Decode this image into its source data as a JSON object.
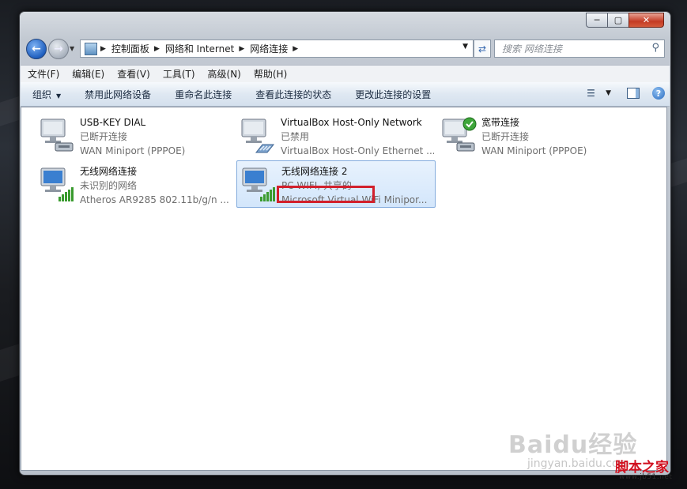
{
  "window": {
    "caption_buttons": {
      "minimize": "─",
      "maximize": "▢",
      "close": "✕"
    }
  },
  "navigation": {
    "back_icon": "arrow-left-icon",
    "forward_icon": "arrow-right-icon",
    "breadcrumb": [
      "控制面板",
      "网络和 Internet",
      "网络连接"
    ],
    "search_placeholder": "搜索 网络连接"
  },
  "menubar": {
    "items": [
      "文件(F)",
      "编辑(E)",
      "查看(V)",
      "工具(T)",
      "高级(N)",
      "帮助(H)"
    ]
  },
  "commandbar": {
    "items": [
      "组织",
      "禁用此网络设备",
      "重命名此连接",
      "查看此连接的状态",
      "更改此连接的设置"
    ]
  },
  "connections": [
    {
      "name": "USB-KEY DIAL",
      "status": "已断开连接",
      "device": "WAN Miniport (PPPOE)",
      "icon": "dialup-connection-icon",
      "selected": false
    },
    {
      "name": "VirtualBox Host-Only Network",
      "status": "已禁用",
      "device": "VirtualBox Host-Only Ethernet ...",
      "icon": "ethernet-connection-icon",
      "selected": false
    },
    {
      "name": "宽带连接",
      "status": "已断开连接",
      "device": "WAN Miniport (PPPOE)",
      "icon": "broadband-connection-icon",
      "selected": false
    },
    {
      "name": "无线网络连接",
      "status": "未识别的网络",
      "device": "Atheros AR9285 802.11b/g/n ...",
      "icon": "wireless-connection-icon",
      "selected": false
    },
    {
      "name": "无线网络连接 2",
      "status": "PC-WIFI, 共享的",
      "device": "Microsoft Virtual WiFi Minipor...",
      "icon": "wireless-connection-icon",
      "selected": true
    }
  ],
  "watermark": {
    "brand": "Baidu经验",
    "url": "jingyan.baidu.com"
  },
  "site_logo": {
    "name": "脚本之家",
    "url": "www.jb51.net"
  },
  "colors": {
    "highlight_box": "#d2202c",
    "selection_bg": "#d3e6fb",
    "status_text": "#6d6d6d"
  }
}
